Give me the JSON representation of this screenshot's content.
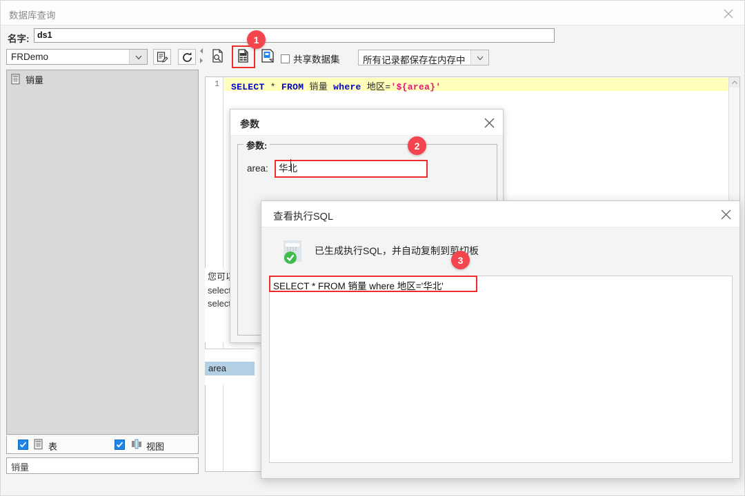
{
  "window": {
    "title": "数据库查询",
    "close_icon": "close-icon"
  },
  "name_row": {
    "label": "名字:",
    "value": "ds1"
  },
  "left_panel": {
    "connection": {
      "value": "FRDemo",
      "dropdown_icon": "chevron-down-icon"
    },
    "buttons": [
      {
        "name": "edit-datasource-button",
        "icon": "document-edit-icon"
      },
      {
        "name": "refresh-button",
        "icon": "refresh-icon"
      }
    ],
    "tree": {
      "items": [
        {
          "label": "销量",
          "icon": "table-icon"
        }
      ]
    },
    "filters": [
      {
        "label": "表",
        "checked": true,
        "icon": "table-icon"
      },
      {
        "label": "视图",
        "icon": "view-icon",
        "checked": true
      }
    ],
    "bottom_field_value": "销量"
  },
  "toolbar": {
    "buttons": [
      {
        "name": "preview-button",
        "icon": "document-search-icon"
      },
      {
        "name": "view-executed-sql-button",
        "icon": "document-grid-icon",
        "highlighted": true
      },
      {
        "name": "save-button",
        "icon": "save-icon"
      }
    ],
    "shared_dataset": {
      "label": "共享数据集",
      "checked": false
    },
    "memory_mode": {
      "value": "所有记录都保存在内存中",
      "dropdown_icon": "chevron-down-icon"
    }
  },
  "editor": {
    "line_number": "1",
    "tokens": [
      {
        "text": "SELECT",
        "type": "keyword"
      },
      {
        "text": " * ",
        "type": "plain"
      },
      {
        "text": "FROM",
        "type": "keyword"
      },
      {
        "text": " 销量 ",
        "type": "table"
      },
      {
        "text": "where",
        "type": "keyword"
      },
      {
        "text": " 地区=",
        "type": "plain"
      },
      {
        "text": "'${area}'",
        "type": "variable"
      }
    ],
    "full_text": "SELECT * FROM 销量 where 地区='${area}'"
  },
  "background_hints": {
    "lines": [
      "您可以键入",
      "select * fr",
      "select * fr"
    ],
    "selected_param": "area"
  },
  "param_dialog": {
    "title": "参数",
    "close_icon": "close-icon",
    "fieldset_legend": "参数:",
    "field": {
      "label": "area:",
      "value": "华北"
    }
  },
  "sql_dialog": {
    "title": "查看执行SQL",
    "close_icon": "close-icon",
    "message": "已生成执行SQL，并自动复制到剪切板",
    "message_icon": "clipboard-success-icon",
    "result_sql": "SELECT * FROM 销量 where 地区='华北'"
  },
  "badges": [
    {
      "number": "1"
    },
    {
      "number": "2"
    },
    {
      "number": "3"
    }
  ],
  "colors": {
    "badge_red": "#f4444e",
    "highlight_red": "#ee2b2b",
    "code_highlight": "#ffffbb",
    "keyword_blue": "#0000d0",
    "variable_pink": "#e0157a",
    "checkbox_blue": "#1e86e8",
    "success_green": "#3fbb4f",
    "selection_blue": "#b3d0e4"
  }
}
